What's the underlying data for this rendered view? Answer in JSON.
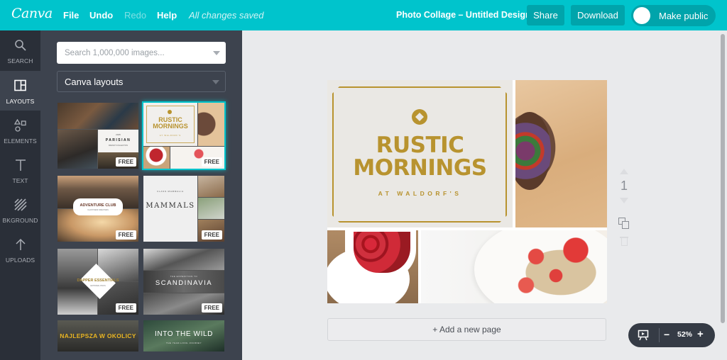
{
  "topbar": {
    "logo": "Canva",
    "menu": [
      {
        "label": "File",
        "enabled": true
      },
      {
        "label": "Undo",
        "enabled": true
      },
      {
        "label": "Redo",
        "enabled": false
      },
      {
        "label": "Help",
        "enabled": true
      }
    ],
    "save_status": "All changes saved",
    "document_title": "Photo Collage – Untitled Design",
    "share_label": "Share",
    "download_label": "Download",
    "make_public_label": "Make public",
    "make_public_on": false,
    "accent_color": "#00c4cc"
  },
  "leftnav": {
    "items": [
      {
        "label": "SEARCH",
        "icon": "search-icon",
        "active": false
      },
      {
        "label": "LAYOUTS",
        "icon": "layout-icon",
        "active": true
      },
      {
        "label": "ELEMENTS",
        "icon": "shapes-icon",
        "active": false
      },
      {
        "label": "TEXT",
        "icon": "text-icon",
        "active": false
      },
      {
        "label": "BKGROUND",
        "icon": "background-pattern-icon",
        "active": false
      },
      {
        "label": "UPLOADS",
        "icon": "upload-arrow-icon",
        "active": false
      }
    ]
  },
  "panel": {
    "search_placeholder": "Search 1,000,000 images...",
    "search_value": "",
    "layout_filter": "Canva layouts",
    "free_badge": "FREE",
    "layouts": [
      {
        "name": "Parisian",
        "kicker": "2015",
        "title": "PARISIAN",
        "subtitle": "FRENCH COLLECTION",
        "free": true,
        "selected": false
      },
      {
        "name": "Rustic Mornings",
        "title": "RUSTIC MORNINGS",
        "subtitle": "AT WALDORF'S",
        "free": true,
        "selected": true
      },
      {
        "name": "Adventure Club",
        "title": "ADVENTURE CLUB",
        "subtitle": "CLASH NEW CREATIVES",
        "free": true,
        "selected": false
      },
      {
        "name": "Mammals",
        "kicker": "CLASS MAMMALIA",
        "title": "MAMMALS",
        "free": true,
        "selected": false
      },
      {
        "name": "Dapper Essentials",
        "title": "DAPPER ESSENTIALS",
        "subtitle": "EDITORIAL PICKS",
        "free": true,
        "selected": false
      },
      {
        "name": "Scandinavia",
        "kicker": "THE EXPEDITION TO",
        "title": "SCANDINAVIA",
        "free": true,
        "selected": false
      },
      {
        "name": "Najlepsza w okolicy",
        "title": "NAJLEPSZA W OKOLICY",
        "free": false,
        "selected": false
      },
      {
        "name": "Into the Wild",
        "title": "INTO THE WILD",
        "subtitle": "THE YEAR-LONG JOURNEY",
        "free": false,
        "selected": false
      }
    ]
  },
  "canvas": {
    "design": {
      "title_line1": "RUSTIC",
      "title_line2": "MORNINGS",
      "subtitle": "AT WALDORF'S",
      "gold_color": "#b8932f",
      "photos": [
        "salad bowl",
        "raspberries in cup",
        "oats with strawberries"
      ]
    },
    "page_number": "1",
    "add_page_label": "+ Add a new page",
    "zoom_level": "52%"
  }
}
